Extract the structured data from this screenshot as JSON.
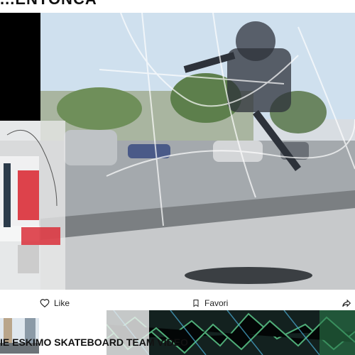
{
  "header": {
    "title": "...ENTONCA"
  },
  "player": {
    "bg_sky": "#cfe0ee",
    "bg_road": "#9aa1a6",
    "accent_red": "#d9232e"
  },
  "actions": {
    "like_label": "Like",
    "favorite_label": "Favori",
    "share_icon": "share-icon"
  },
  "video": {
    "title": "IE ESKIMO SKATEBOARD TEAM VIDEO"
  }
}
